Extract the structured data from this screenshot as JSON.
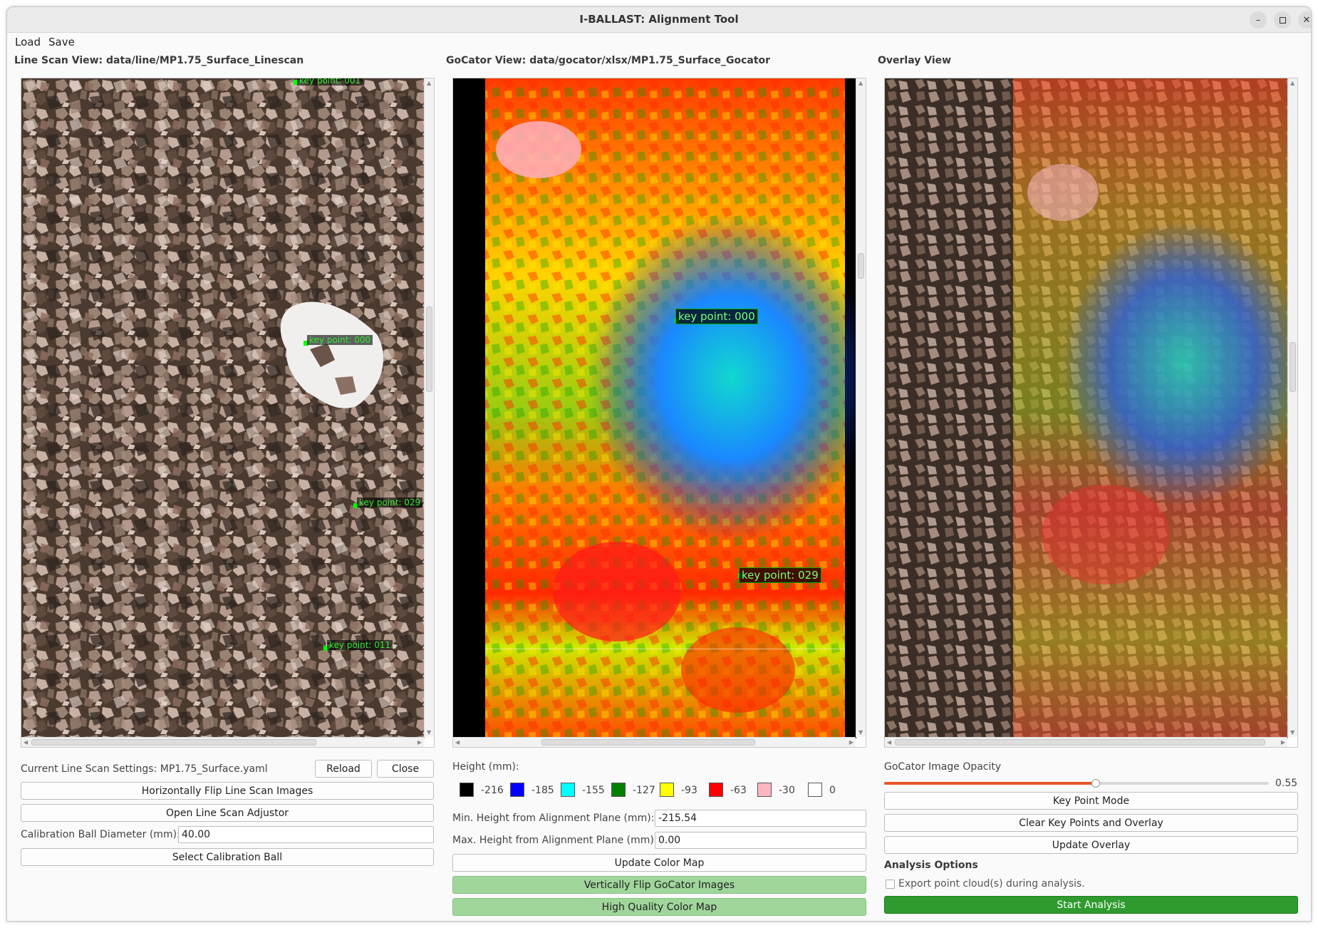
{
  "window": {
    "title": "I-BALLAST: Alignment Tool"
  },
  "menu": {
    "load": "Load",
    "save": "Save"
  },
  "linescan": {
    "title": "Line Scan View: data/line/MP1.75_Surface_Linescan",
    "key_points": [
      "key point: 001",
      "key point: 000",
      "key point: 029",
      "key point: 011"
    ],
    "settings_label": "Current Line Scan Settings: MP1.75_Surface.yaml",
    "reload": "Reload",
    "close": "Close",
    "flip": "Horizontally Flip Line Scan Images",
    "adjustor": "Open Line Scan Adjustor",
    "ball_label": "Calibration Ball Diameter (mm):",
    "ball_value": "40.00",
    "select_ball": "Select Calibration Ball"
  },
  "gocator": {
    "title": "GoCator View: data/gocator/xlsx/MP1.75_Surface_Gocator",
    "key_points": [
      "key point: 000",
      "key point: 029"
    ],
    "height_label": "Height (mm):",
    "legend": [
      {
        "label": "-216",
        "color": "#000000"
      },
      {
        "label": "-185",
        "color": "#0000ff"
      },
      {
        "label": "-155",
        "color": "#00ffff"
      },
      {
        "label": "-127",
        "color": "#008000"
      },
      {
        "label": "-93",
        "color": "#ffff00"
      },
      {
        "label": "-63",
        "color": "#ff0000"
      },
      {
        "label": "-30",
        "color": "#ffb6c1"
      },
      {
        "label": "0",
        "color": "#ffffff"
      }
    ],
    "min_label": "Min. Height from Alignment Plane (mm):",
    "min_value": "-215.54",
    "max_label": "Max. Height from Alignment Plane (mm):",
    "max_value": "0.00",
    "update_map": "Update Color Map",
    "vflip": "Vertically Flip GoCator Images",
    "hq": "High Quality Color Map"
  },
  "overlay": {
    "title": "Overlay View",
    "opacity_label": "GoCator Image Opacity",
    "opacity_value": "0.55",
    "opacity": 0.55,
    "key_point_mode": "Key Point Mode",
    "clear": "Clear Key Points and Overlay",
    "update": "Update Overlay",
    "analysis_header": "Analysis Options",
    "export_label": "Export point cloud(s) during analysis.",
    "start": "Start Analysis"
  },
  "colors": {
    "accent": "#e8562a",
    "green_button": "#a0d69b",
    "start_button": "#2f9b2f"
  }
}
